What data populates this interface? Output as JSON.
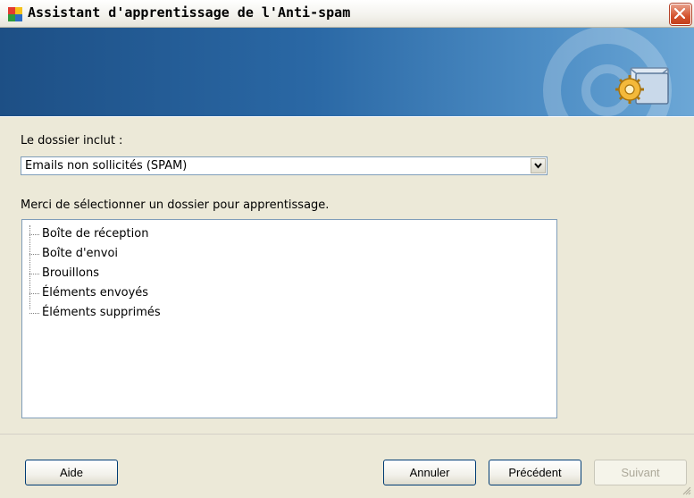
{
  "window": {
    "title": "Assistant d'apprentissage de l'Anti-spam"
  },
  "form": {
    "folder_label": "Le dossier inclut :",
    "folder_selected": "Emails non sollicités (SPAM)",
    "instruction": "Merci de sélectionner un dossier pour apprentissage."
  },
  "tree": {
    "items": [
      {
        "label": "Boîte de réception"
      },
      {
        "label": "Boîte d'envoi"
      },
      {
        "label": "Brouillons"
      },
      {
        "label": "Éléments envoyés"
      },
      {
        "label": "Éléments supprimés"
      }
    ]
  },
  "buttons": {
    "help": "Aide",
    "cancel": "Annuler",
    "previous": "Précédent",
    "next": "Suivant"
  },
  "colors": {
    "banner_dark": "#1d4f85",
    "banner_light": "#6ca7d6",
    "close_red": "#d4532e"
  },
  "icons": {
    "app": "avg-app-icon",
    "close": "close-icon",
    "banner": "mail-gear-icon",
    "dropdown": "chevron-down-icon"
  }
}
